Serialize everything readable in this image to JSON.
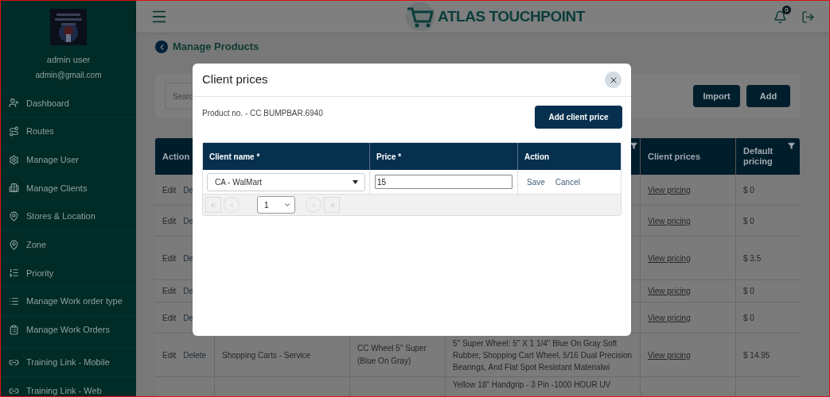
{
  "sidebar": {
    "user_name": "admin user",
    "user_email": "admin@gmail.com",
    "items": [
      {
        "label": "Dashboard"
      },
      {
        "label": "Routes"
      },
      {
        "label": "Manage User"
      },
      {
        "label": "Manage Clients"
      },
      {
        "label": "Stores & Location"
      },
      {
        "label": "Zone"
      },
      {
        "label": "Priority"
      },
      {
        "label": "Manage Work order type"
      },
      {
        "label": "Manage Work Orders"
      },
      {
        "label": "Training Link - Mobile"
      },
      {
        "label": "Training Link - Web"
      }
    ]
  },
  "topbar": {
    "brand": "ATLAS TOUCHPOINT",
    "notification_count": "0"
  },
  "page": {
    "title": "Manage Products",
    "search": {
      "placeholder": "Searc"
    },
    "buttons": [
      "Import",
      "Add"
    ]
  },
  "table": {
    "columns": [
      "Action",
      "Client prices",
      "Default pricing"
    ],
    "rows": [
      {
        "actions": [
          "Edit",
          "De"
        ],
        "client_prices": "View pricing",
        "default_pricing": "$ 0"
      },
      {
        "actions": [
          "Edit",
          "De"
        ],
        "client_prices": "View pricing",
        "default_pricing": "$ 0"
      },
      {
        "actions": [
          "Edit",
          "De"
        ],
        "client_prices": "View pricing",
        "default_pricing": "$ 3.5"
      },
      {
        "actions": [
          "Edit",
          "De"
        ],
        "client_prices": "View pricing",
        "default_pricing": "$ 0"
      },
      {
        "actions": [
          "Edit",
          "De"
        ],
        "client_prices": "View pricing",
        "default_pricing": "$ 0"
      },
      {
        "actions": [
          "Edit",
          "Delete"
        ],
        "category": "Shopping Carts - Service",
        "product": "CC Wheel 5\" Super (Blue On Gray)",
        "description": "5\" Super Wheel: 5\" X 1 1/4\" Blue On Gray Soft Rubber, Shopping Cart Wheel, 5/16 Dual Precision Bearings, And Flat Spot Resistant Materialwi",
        "client_prices": "View pricing",
        "default_pricing": "$ 14.95"
      },
      {
        "description": "Yellow 18\" Handgrip - 3 Pin -1000 HOUR UV"
      }
    ]
  },
  "modal": {
    "title": "Client prices",
    "product_no": "Product no. - CC BUMPBAR.6940",
    "add_button": "Add client price",
    "columns": [
      "Client name *",
      "Price *",
      "Action"
    ],
    "row": {
      "client": "CA - WalMart",
      "price": "15",
      "actions": [
        "Save",
        "Cancel"
      ]
    },
    "pager": {
      "page": "1"
    }
  }
}
